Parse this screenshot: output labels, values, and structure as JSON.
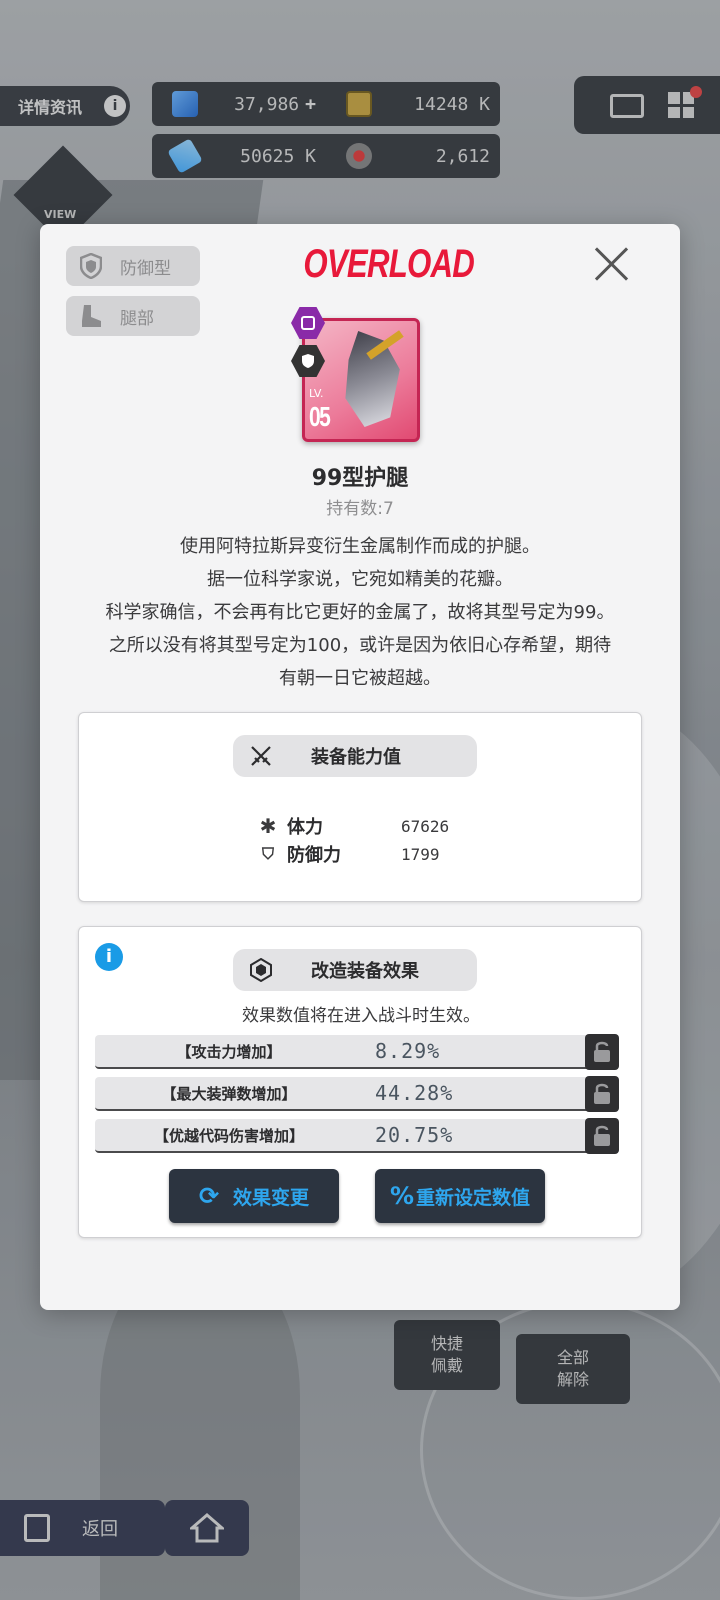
{
  "hud": {
    "info_label": "详情资讯",
    "info_icon": "i",
    "resources": [
      {
        "icon": "crystal-icon",
        "value": "37,986",
        "plus": "+"
      },
      {
        "icon": "credit-card-icon",
        "value": "14248 K"
      },
      {
        "icon": "battle-data-icon",
        "value": "50625 K"
      },
      {
        "icon": "core-dust-icon",
        "value": "2,612"
      }
    ],
    "view_label": "VIEW"
  },
  "modal": {
    "tags": [
      {
        "icon": "shield-icon",
        "label": "防御型"
      },
      {
        "icon": "boot-icon",
        "label": "腿部"
      }
    ],
    "brand": "OVERLOAD",
    "card": {
      "lv_label": "LV.",
      "level": "05"
    },
    "item_name": "99型护腿",
    "owned_count": "持有数:7",
    "description": [
      "使用阿特拉斯异变衍生金属制作而成的护腿。",
      "据一位科学家说，它宛如精美的花瓣。",
      "科学家确信，不会再有比它更好的金属了，故将其型号定为99。",
      "之所以没有将其型号定为100，或许是因为依旧心存希望，期待",
      "有朝一日它被超越。"
    ],
    "stats_panel": {
      "title": "装备能力值",
      "stats": [
        {
          "icon": "✱",
          "name": "体力",
          "value": "67626"
        },
        {
          "icon": "⛉",
          "name": "防御力",
          "value": "1799"
        }
      ]
    },
    "effects_panel": {
      "title": "改造装备效果",
      "hint": "效果数值将在进入战斗时生效。",
      "effects": [
        {
          "name": "【攻击力增加】",
          "value": "8.29%"
        },
        {
          "name": "【最大装弹数增加】",
          "value": "44.28%"
        },
        {
          "name": "【优越代码伤害增加】",
          "value": "20.75%"
        }
      ],
      "change_button": "效果变更",
      "reset_button": "重新设定数值"
    }
  },
  "background_ui": {
    "quick_equip": "快捷\n佩戴",
    "unequip_all": "全部\n解除",
    "back": "返回"
  },
  "colors": {
    "brand_red": "#e8193a",
    "accent_blue": "#2ea6ee",
    "info_blue": "#1a9be6",
    "card_purple": "#8a2aa8"
  }
}
